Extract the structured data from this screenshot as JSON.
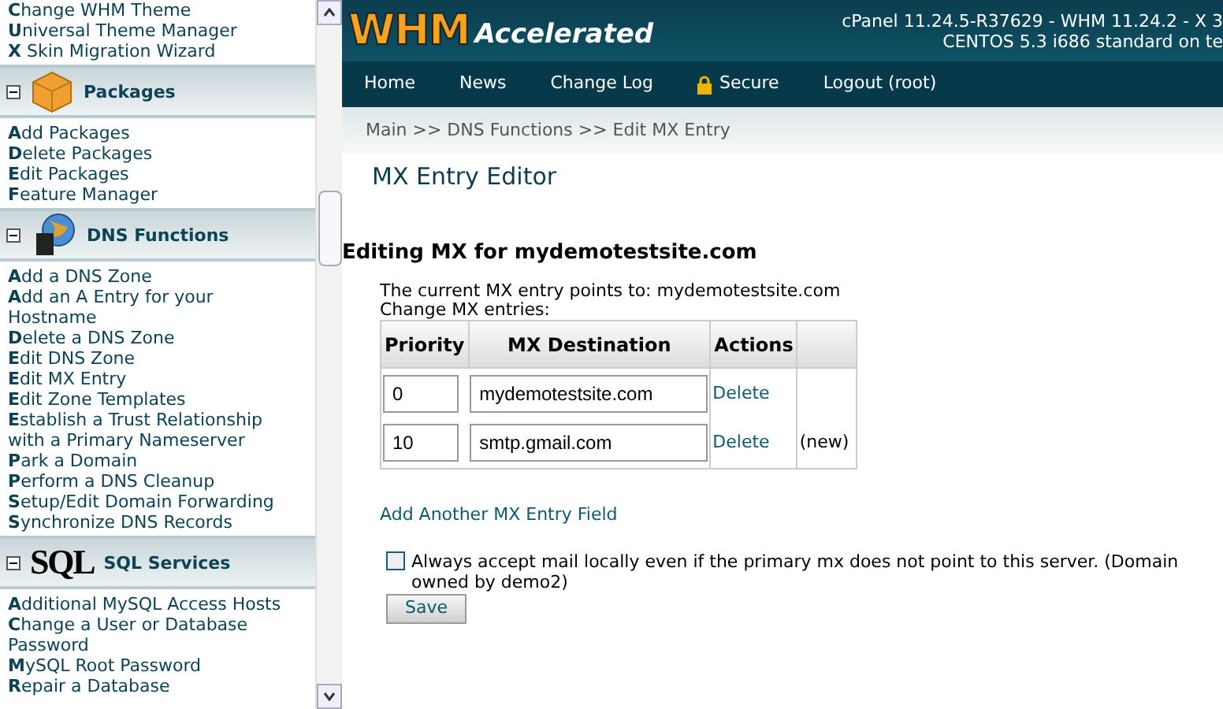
{
  "sidebar": {
    "top_items": [
      "**C**hange WHM Theme",
      "**U**niversal Theme Manager",
      "**X** Skin Migration Wizard"
    ],
    "sections": [
      {
        "title": "Packages",
        "kind": "box",
        "expanded": true,
        "items": [
          "**A**dd Packages",
          "**D**elete Packages",
          "**E**dit Packages",
          "**F**eature Manager"
        ]
      },
      {
        "title": "DNS Functions",
        "kind": "globe",
        "expanded": true,
        "items": [
          "**A**dd a DNS Zone",
          "**A**dd an A Entry for your Hostname",
          "**D**elete a DNS Zone",
          "**E**dit DNS Zone",
          "**E**dit MX Entry",
          "**E**dit Zone Templates",
          "**E**stablish a Trust Relationship with a Primary Nameserver",
          "**P**ark a Domain",
          "**P**erform a DNS Cleanup",
          "**S**etup/Edit Domain Forwarding",
          "**S**ynchronize DNS Records"
        ]
      },
      {
        "title": "SQL Services",
        "kind": "sql",
        "logo_text": "SQL",
        "expanded": true,
        "items": [
          "**A**dditional MySQL Access Hosts",
          "**C**hange a User or Database Password",
          "**M**ySQL Root Password",
          "**R**epair a Database"
        ]
      }
    ]
  },
  "header": {
    "logo_main": "WHM",
    "logo_sub": "Accelerated",
    "version_line": "cPanel 11.24.5-R37629 - WHM 11.24.2 - X 3",
    "os_line": "CENTOS 5.3 i686 standard on te"
  },
  "nav": [
    {
      "label": "Home",
      "kind": "link"
    },
    {
      "label": "News",
      "kind": "link"
    },
    {
      "label": "Change Log",
      "kind": "link"
    },
    {
      "label": "Secure",
      "kind": "lock"
    },
    {
      "label": "Logout (root)",
      "kind": "link"
    }
  ],
  "breadcrumb": "Main >> DNS Functions >> Edit MX Entry",
  "page_title": "MX Entry Editor",
  "subtitle": "Editing MX for mydemotestsite.com",
  "current_text": "The current MX entry points to: mydemotestsite.com",
  "change_text": "Change MX entries:",
  "table": {
    "columns": [
      "Priority",
      "MX Destination",
      "Actions"
    ],
    "rows": [
      {
        "priority": "0",
        "destination": "mydemotestsite.com",
        "action": "Delete"
      },
      {
        "priority": "10",
        "destination": "smtp.gmail.com",
        "action": "Delete",
        "note": "(new)"
      }
    ]
  },
  "add_link": "Add Another MX Entry Field",
  "accept_local": {
    "label": "Always accept mail locally even if the primary mx does not point to this server. (Domain owned by demo2)",
    "checked": false
  },
  "save_button": "Save"
}
